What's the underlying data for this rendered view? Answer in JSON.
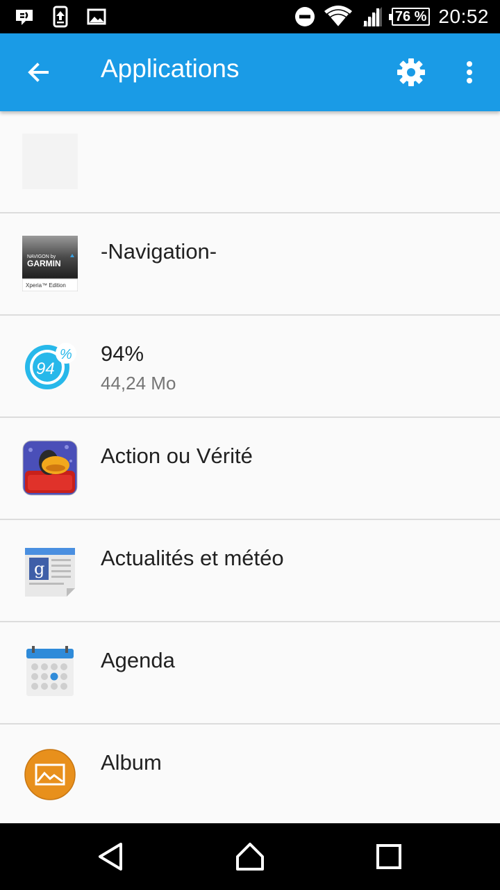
{
  "status_bar": {
    "time": "20:52",
    "battery": "76 %",
    "left_icons": [
      "message-icon",
      "upload-icon",
      "image-icon"
    ],
    "right_icons": [
      "do-not-disturb-icon",
      "wifi-icon",
      "signal-icon",
      "battery-icon"
    ]
  },
  "app_bar": {
    "title": "Applications",
    "background": "#1a9be6",
    "icons": [
      "back-arrow-icon",
      "gear-icon",
      "more-vert-icon"
    ]
  },
  "apps": [
    {
      "name": "",
      "size": "",
      "icon": "blank-app-icon"
    },
    {
      "name": "-Navigation-",
      "size": "",
      "icon": "navigon-garmin-icon",
      "icon_text": [
        "NAVIGON by",
        "GARMIN",
        "Xperia™ Edition"
      ]
    },
    {
      "name": "94%",
      "size": "44,24 Mo",
      "icon": "94-percent-icon",
      "icon_text": [
        "94",
        "%"
      ]
    },
    {
      "name": "Action ou Vérité",
      "size": "",
      "icon": "action-ou-verite-icon"
    },
    {
      "name": "Actualités et météo",
      "size": "",
      "icon": "google-news-icon",
      "icon_text": [
        "g"
      ]
    },
    {
      "name": "Agenda",
      "size": "",
      "icon": "calendar-icon"
    },
    {
      "name": "Album",
      "size": "",
      "icon": "album-icon"
    }
  ],
  "nav_bar": {
    "buttons": [
      "back-triangle-icon",
      "home-icon",
      "recents-icon"
    ]
  }
}
